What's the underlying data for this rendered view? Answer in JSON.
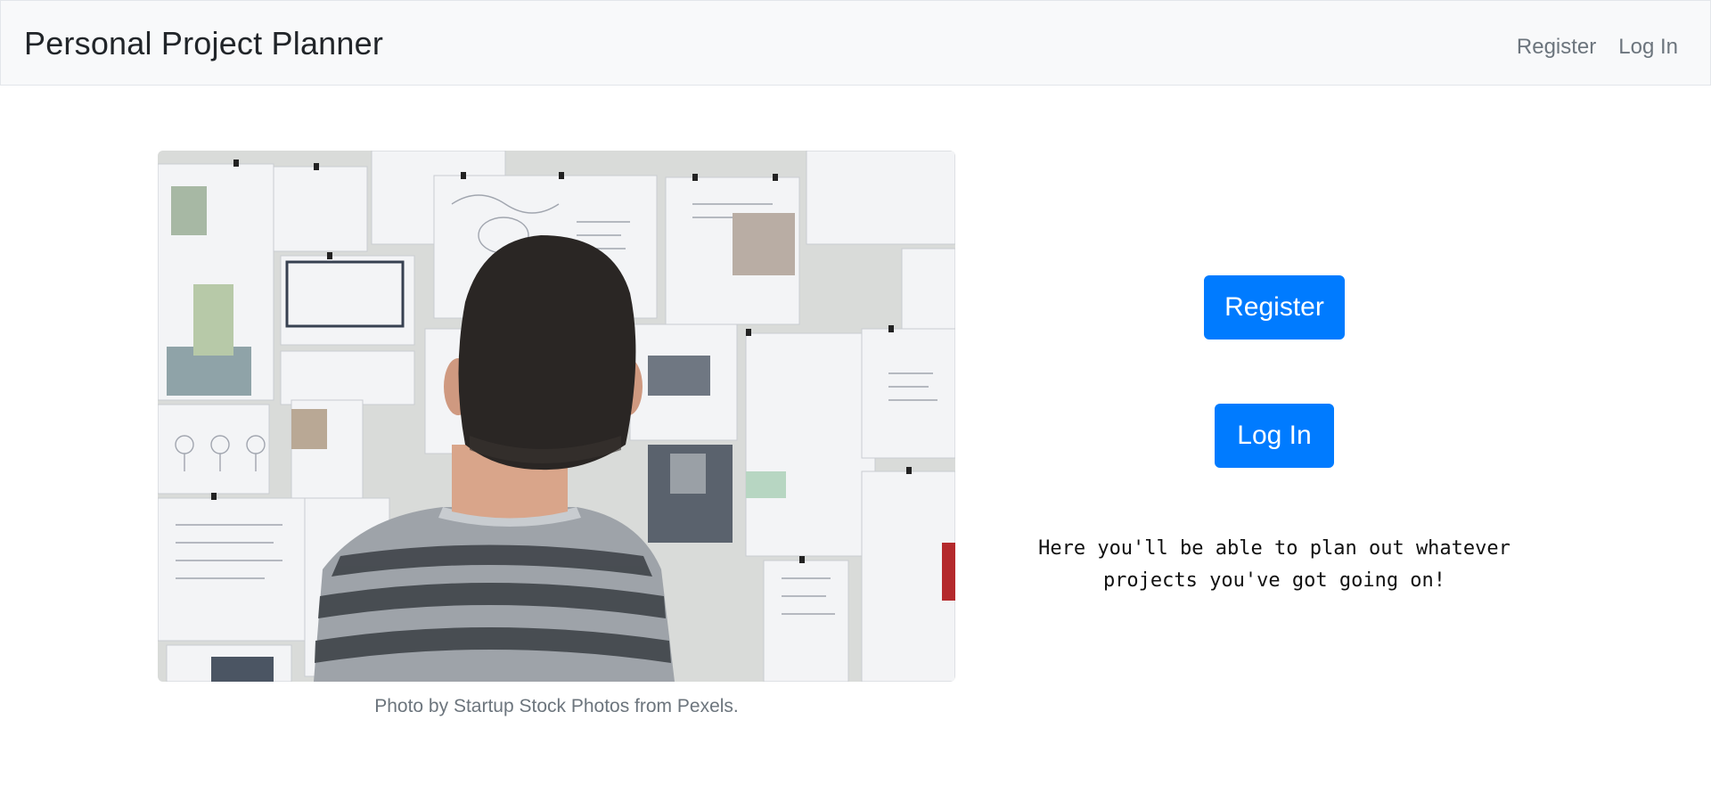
{
  "navbar": {
    "brand": "Personal Project Planner",
    "links": [
      {
        "label": "Register"
      },
      {
        "label": "Log In"
      }
    ]
  },
  "hero": {
    "image_alt": "Person looking at a wall covered with project sketches and papers",
    "caption": "Photo by Startup Stock Photos from Pexels."
  },
  "actions": {
    "register_label": "Register",
    "login_label": "Log In"
  },
  "tagline": "Here you'll be able to plan out whatever projects you've got going on!",
  "colors": {
    "primary": "#007bff",
    "navbar_bg": "#f8f9fa",
    "muted_text": "#6c757d"
  }
}
